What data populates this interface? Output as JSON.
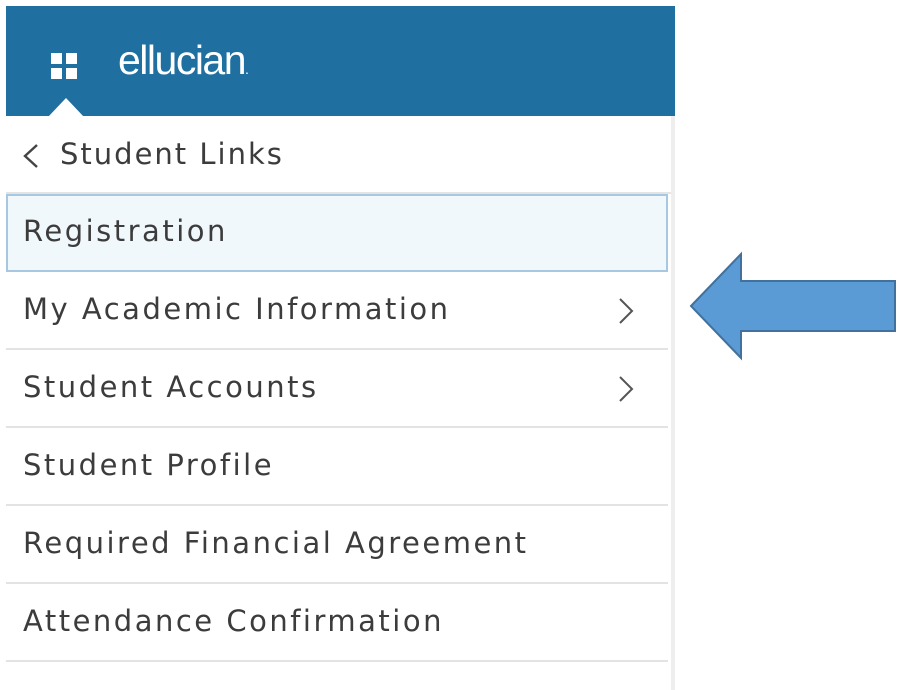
{
  "header": {
    "brand": "ellucian",
    "brand_dot": ".",
    "apps_icon": "apps-grid-icon",
    "background_color": "#1f6fa1"
  },
  "back": {
    "label": "Student Links",
    "icon": "chevron-left-icon"
  },
  "menu": {
    "items": [
      {
        "label": "Registration",
        "selected": true,
        "has_submenu": false
      },
      {
        "label": "My Academic Information",
        "selected": false,
        "has_submenu": true
      },
      {
        "label": "Student Accounts",
        "selected": false,
        "has_submenu": true
      },
      {
        "label": "Student Profile",
        "selected": false,
        "has_submenu": false
      },
      {
        "label": "Required Financial Agreement",
        "selected": false,
        "has_submenu": false
      },
      {
        "label": "Attendance Confirmation",
        "selected": false,
        "has_submenu": false
      }
    ],
    "submenu_icon": "chevron-right-icon",
    "selected_background": "#f1f8fc",
    "selected_border": "#a7c8e3"
  },
  "annotation": {
    "icon": "left-arrow-icon",
    "fill_color": "#5b9bd5",
    "stroke_color": "#41719c",
    "points_to": "My Academic Information"
  }
}
